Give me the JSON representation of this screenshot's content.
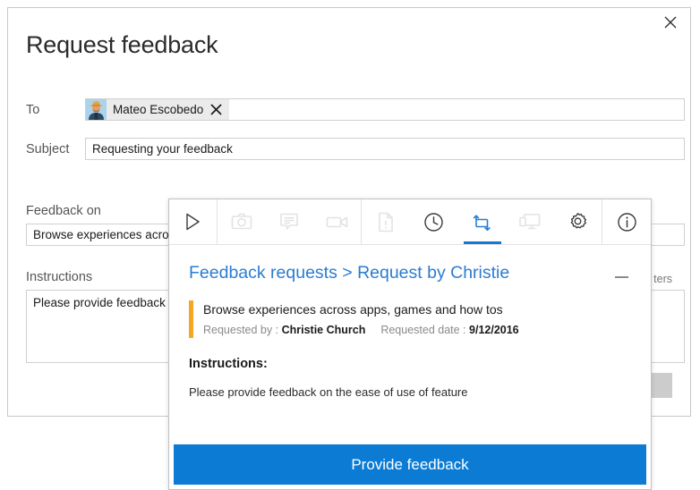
{
  "dialog": {
    "title": "Request feedback",
    "close_label": "close-icon",
    "to_label": "To",
    "recipient": {
      "name": "Mateo Escobedo",
      "remove_label": "remove"
    },
    "subject_label": "Subject",
    "subject_value": "Requesting your feedback",
    "feedback_on_label": "Feedback on",
    "feedback_on_value": "Browse experiences across apps, games and how tos",
    "instructions_label": "Instructions",
    "instructions_value": "Please provide feedback on the ease of use of feature",
    "char_counter": "ters",
    "action_button": ""
  },
  "popup": {
    "toolbar": [
      {
        "name": "play-icon",
        "label": "Play",
        "state": "enabled"
      },
      {
        "name": "camera-icon",
        "label": "Screenshot",
        "state": "disabled"
      },
      {
        "name": "comment-icon",
        "label": "Comment",
        "state": "disabled"
      },
      {
        "name": "video-camera-icon",
        "label": "Record video",
        "state": "disabled"
      },
      {
        "name": "document-icon",
        "label": "Document",
        "state": "disabled"
      },
      {
        "name": "clock-icon",
        "label": "History",
        "state": "enabled"
      },
      {
        "name": "repeat-icon",
        "label": "Feedback requests",
        "state": "active"
      },
      {
        "name": "presentation-icon",
        "label": "Presentation",
        "state": "disabled"
      },
      {
        "name": "gear-icon",
        "label": "Settings",
        "state": "enabled"
      },
      {
        "name": "info-icon",
        "label": "Information",
        "state": "enabled"
      }
    ],
    "breadcrumb": "Feedback requests > Request by Christie",
    "minimize_label": "minimize",
    "request_title": "Browse experiences across apps, games and how tos",
    "requested_by_label": "Requested by :",
    "requested_by_value": "Christie Church",
    "requested_date_label": "Requested date :",
    "requested_date_value": "9/12/2016",
    "instructions_heading": "Instructions:",
    "instructions_body": "Please provide feedback on the ease of use of feature",
    "cta_label": "Provide feedback"
  },
  "colors": {
    "accent_blue": "#0b7bd4",
    "breadcrumb_blue": "#2b7cd3",
    "accent_orange": "#f5a623",
    "disabled_gray": "#e3e3e3"
  }
}
